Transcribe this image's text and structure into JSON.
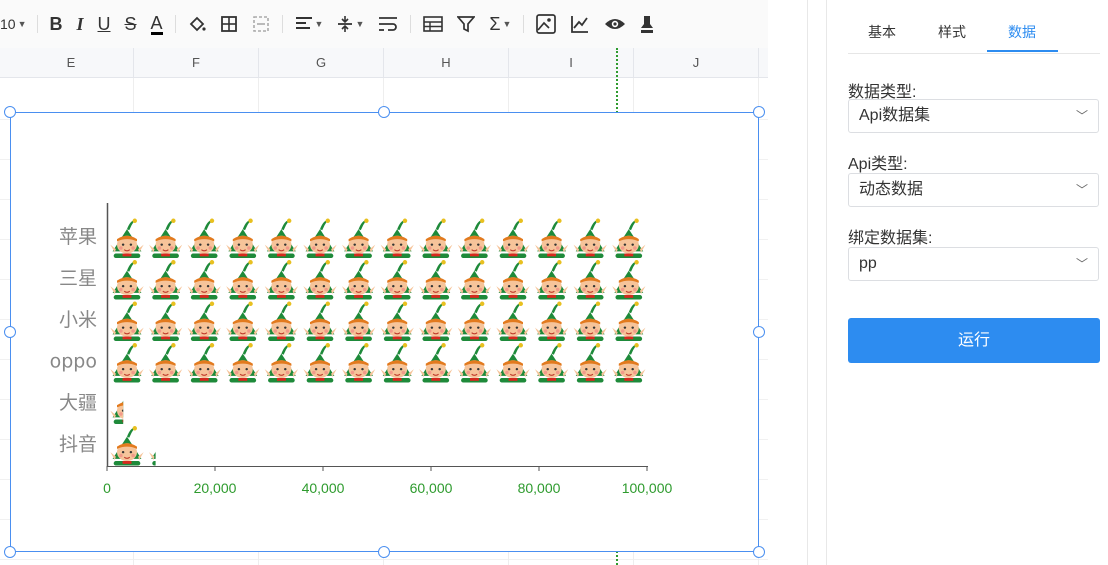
{
  "toolbar": {
    "font_size": "10",
    "bold_label": "B",
    "italic_label": "I",
    "underline_label": "U",
    "strike_label": "S",
    "font_color_label": "A",
    "sum_label": "Σ"
  },
  "sheet": {
    "columns": [
      "E",
      "F",
      "G",
      "H",
      "I",
      "J"
    ]
  },
  "chart_data": {
    "type": "bar",
    "categories": [
      "苹果",
      "三星",
      "小米",
      "oppo",
      "大疆",
      "抖音"
    ],
    "values": [
      100000,
      100000,
      100000,
      100000,
      3000,
      9000
    ],
    "xlim": [
      0,
      100000
    ],
    "x_ticks": [
      "0",
      "20,000",
      "40,000",
      "60,000",
      "80,000",
      "100,000"
    ],
    "x_tick_values": [
      0,
      20000,
      40000,
      60000,
      80000,
      100000
    ],
    "tick_color": "#2e9b2e",
    "category_color": "#888888",
    "symbol": "elf-icon",
    "symbol_colors": {
      "hat": "#1e8a3a",
      "face": "#f6c49a",
      "hair": "#e27a1e"
    },
    "grid": false,
    "legend": "none"
  },
  "panel": {
    "tabs": [
      "基本",
      "样式",
      "数据"
    ],
    "active_tab": "数据",
    "data_type_label": "数据类型:",
    "data_type_value": "Api数据集",
    "api_type_label": "Api类型:",
    "api_type_value": "动态数据",
    "dataset_label": "绑定数据集:",
    "dataset_value": "pp",
    "run_label": "运行"
  },
  "colors": {
    "accent": "#2d8cf0",
    "selection": "#4a8ff0"
  }
}
